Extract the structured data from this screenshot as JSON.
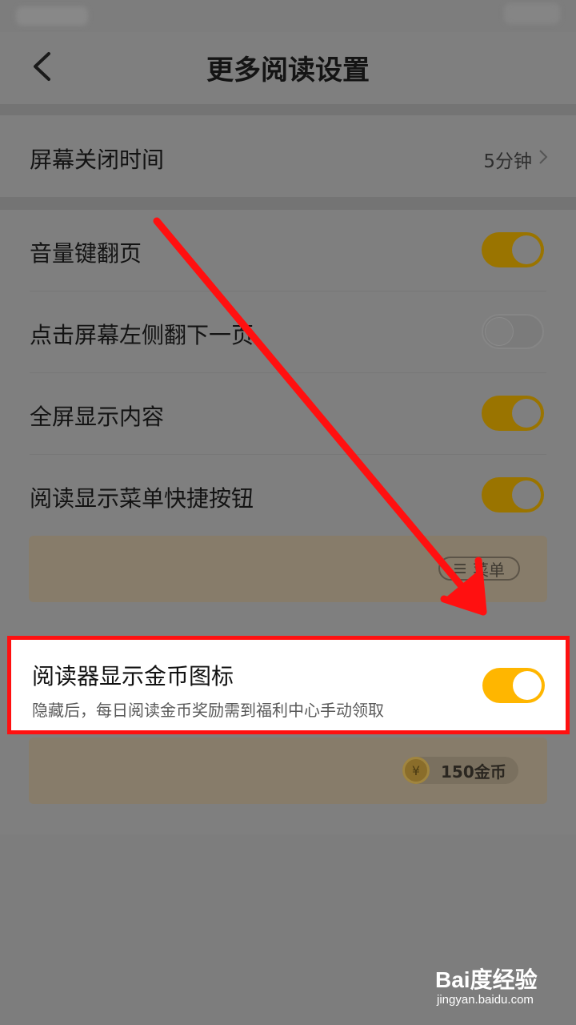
{
  "header": {
    "title": "更多阅读设置"
  },
  "screen_off": {
    "label": "屏幕关闭时间",
    "value": "5分钟"
  },
  "settings": [
    {
      "label": "音量键翻页",
      "on": true
    },
    {
      "label": "点击屏幕左侧翻下一页",
      "on": false
    },
    {
      "label": "全屏显示内容",
      "on": true
    },
    {
      "label": "阅读显示菜单快捷按钮",
      "on": true
    }
  ],
  "menu_preview": {
    "label": "菜单"
  },
  "coin_setting": {
    "label": "阅读器显示金币图标",
    "description": "隐藏后，每日阅读金币奖励需到福利中心手动领取",
    "on": true
  },
  "coin_preview": {
    "symbol": "¥",
    "label": "150金币"
  },
  "watermark": {
    "logo": "Bai度经验",
    "url": "jingyan.baidu.com"
  },
  "colors": {
    "toggle_on": "#ffb600",
    "highlight_border": "#ff1010",
    "arrow": "#ff1010"
  },
  "icons": [
    "back-arrow-icon",
    "chevron-right-icon",
    "menu-lines-icon",
    "coin-icon"
  ]
}
